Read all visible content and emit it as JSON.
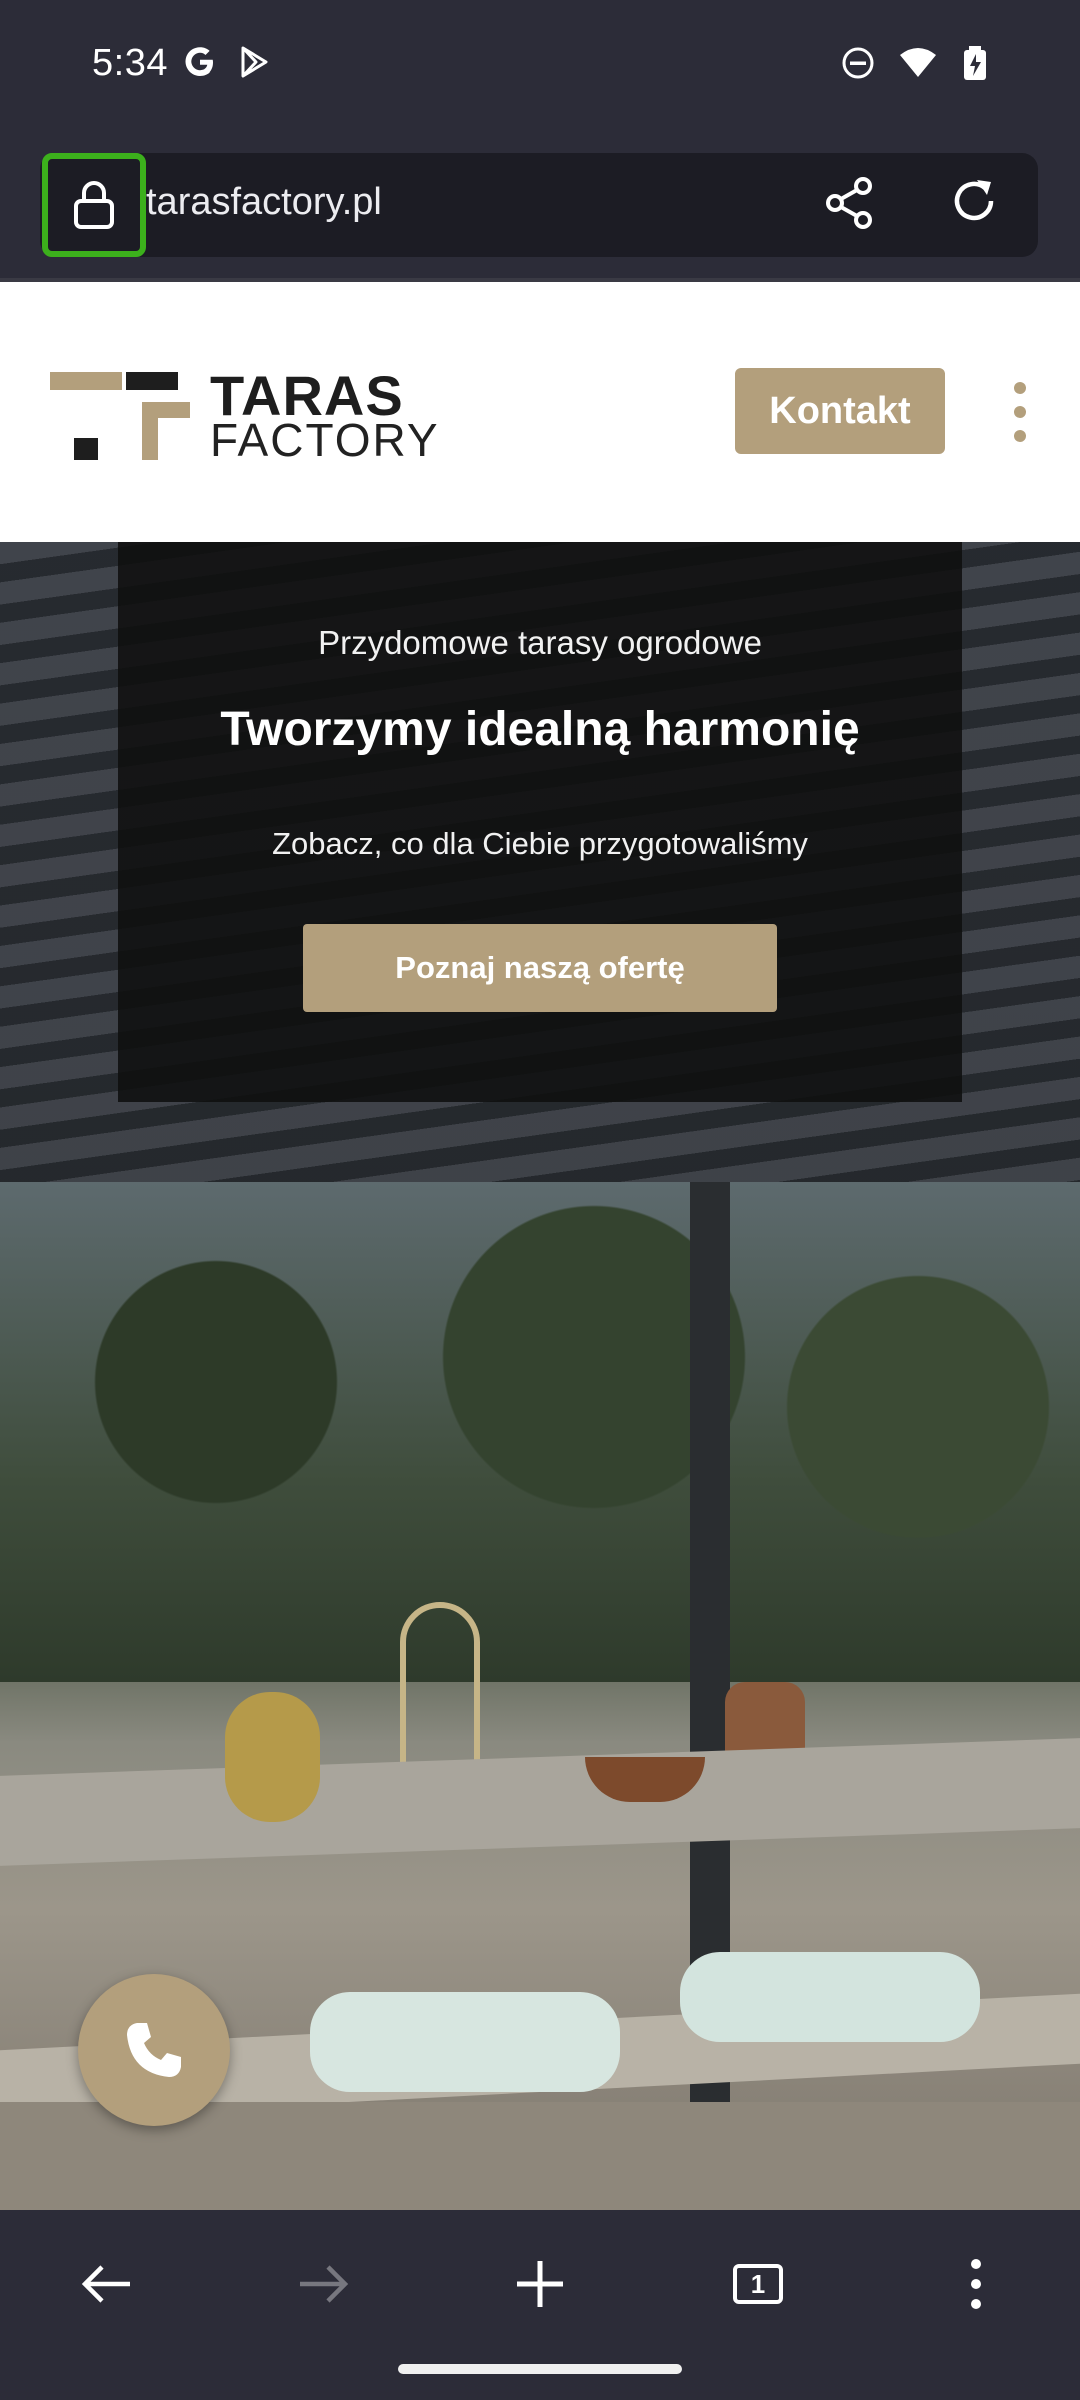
{
  "status_bar": {
    "time": "5:34",
    "left_icons": [
      "google-icon",
      "play-store-icon"
    ],
    "right_icons": [
      "do-not-disturb-icon",
      "wifi-icon",
      "battery-icon"
    ]
  },
  "browser": {
    "url": "tarasfactory.pl",
    "lock_icon": "lock-icon",
    "share_icon": "share-icon",
    "reload_icon": "reload-icon",
    "highlight_color": "#3cb01c"
  },
  "site": {
    "logo_line1": "TARAS",
    "logo_line2": "FACTORY",
    "contact_button": "Kontakt",
    "menu_icon": "more-vertical-icon",
    "brand_color": "#b39f7c"
  },
  "hero": {
    "kicker": "Przydomowe tarasy ogrodowe",
    "title": "Tworzymy idealną harmonię",
    "subtitle": "Zobacz, co dla Ciebie przygotowaliśmy",
    "cta_button": "Poznaj naszą ofertę",
    "phone_icon": "phone-icon"
  },
  "bottom_toolbar": {
    "back_icon": "back-arrow-icon",
    "forward_icon": "forward-arrow-icon",
    "new_tab_icon": "plus-icon",
    "tab_count": "1",
    "menu_icon": "more-vertical-icon"
  }
}
